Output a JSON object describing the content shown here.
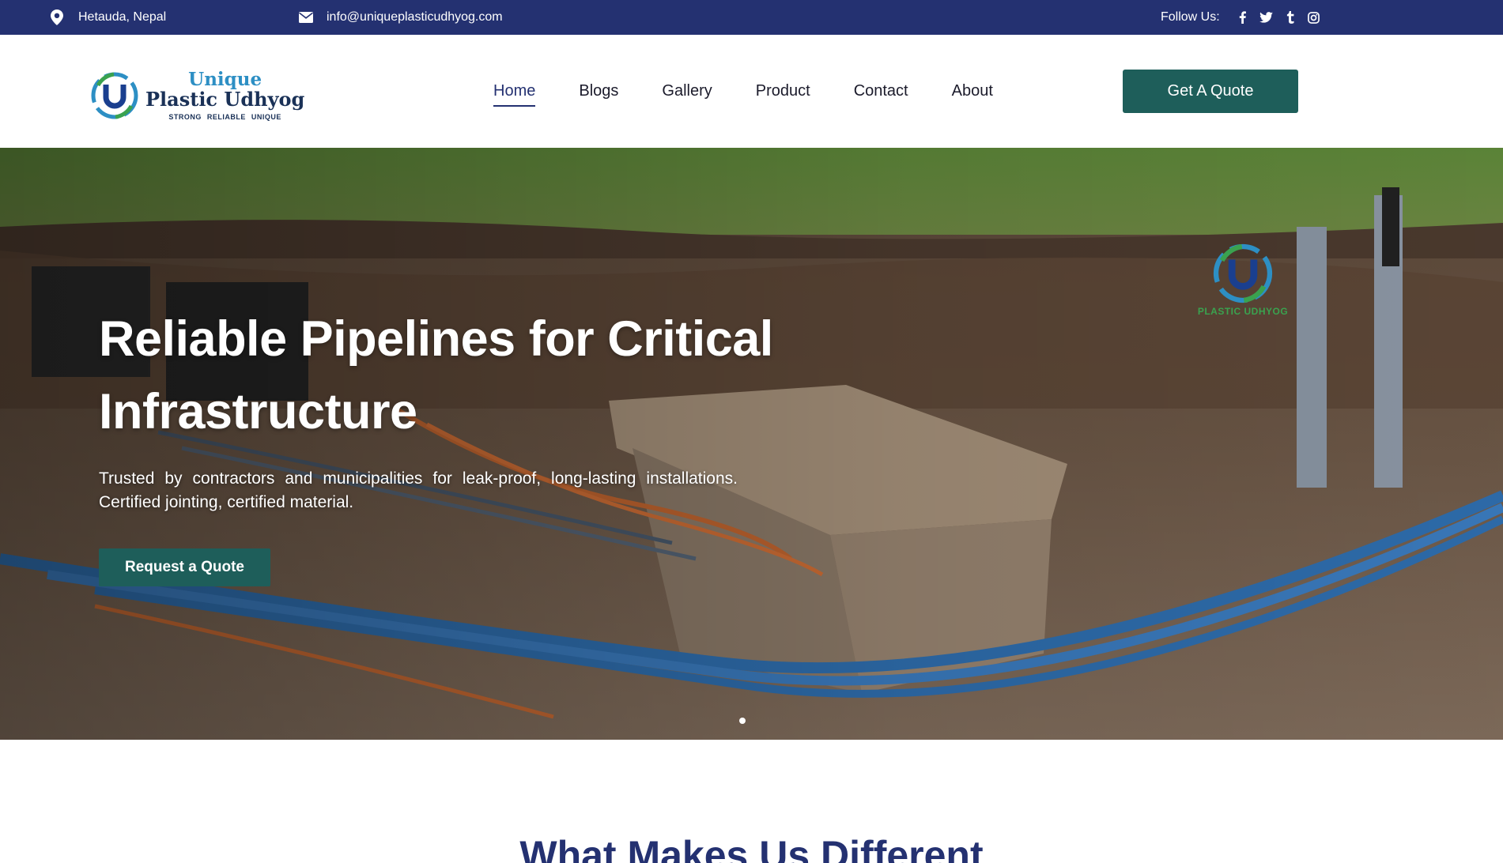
{
  "topbar": {
    "location": "Hetauda, Nepal",
    "email": "info@uniqueplasticudhyog.com",
    "follow_label": "Follow Us:",
    "social_icons": [
      "facebook-icon",
      "twitter-icon",
      "tumblr-icon",
      "instagram-icon"
    ],
    "background": "#243171"
  },
  "logo": {
    "line1": "Unique",
    "line2": "Plastic Udhyog",
    "tagline": "STRONG  RELIABLE  UNIQUE"
  },
  "nav": {
    "items": [
      {
        "label": "Home",
        "active": true
      },
      {
        "label": "Blogs",
        "active": false
      },
      {
        "label": "Gallery",
        "active": false
      },
      {
        "label": "Product",
        "active": false
      },
      {
        "label": "Contact",
        "active": false
      },
      {
        "label": "About",
        "active": false
      }
    ],
    "cta_label": "Get A Quote"
  },
  "hero": {
    "title": "Reliable Pipelines for Critical Infrastructure",
    "subtitle": "Trusted by contractors and municipalities for leak-proof, long-lasting installations. Certified jointing, certified material.",
    "button_label": "Request a Quote",
    "badge_text": "PLASTIC UDHYOG",
    "slide_count": 1,
    "active_slide": 1
  },
  "section": {
    "title": "What Makes Us Different"
  },
  "colors": {
    "primary_navy": "#243171",
    "button_teal": "#1e5e5a",
    "logo_blue": "#2d8fc4",
    "logo_green": "#3aa24f"
  }
}
